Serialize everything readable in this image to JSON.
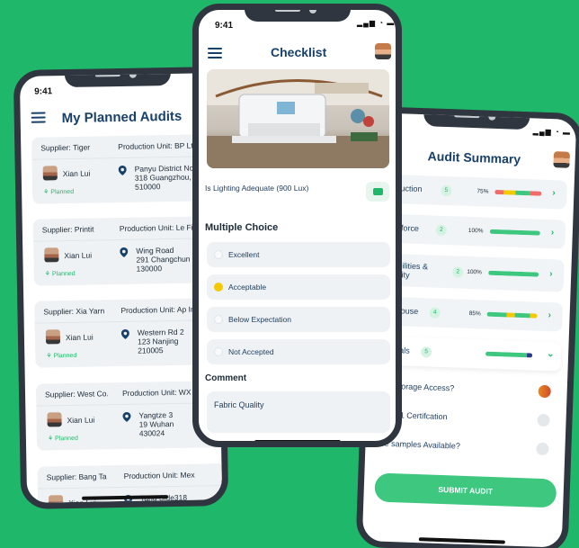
{
  "colors": {
    "background": "#1fb86a",
    "accent": "#1fb86a",
    "title": "#17406a",
    "selected": "#f5c900"
  },
  "left": {
    "time": "9:41",
    "title": "My Planned Audits",
    "audits": [
      {
        "supplier": "Supplier: Tiger",
        "unit": "Production Unit: BP Lt",
        "name": "Xian Lui",
        "status": "Planned",
        "addr": [
          "Panyu District No",
          "318 Guangzhou,",
          "510000"
        ]
      },
      {
        "supplier": "Supplier: Printit",
        "unit": "Production Unit: Le Fi",
        "name": "Xian Lui",
        "status": "Planned",
        "addr": [
          "Wing Road",
          "291 Changchun",
          "130000"
        ]
      },
      {
        "supplier": "Supplier: Xia Yarn",
        "unit": "Production Unit: Ap In",
        "name": "Xian Lui",
        "status": "Planned",
        "addr": [
          "Western Rd 2",
          "123 Nanjing",
          "210005"
        ]
      },
      {
        "supplier": "Supplier: West Co.",
        "unit": "Production Unit: WX L",
        "name": "Xian Lui",
        "status": "Planned",
        "addr": [
          "Yangtze 3",
          "19 Wuhan",
          "430024"
        ]
      },
      {
        "supplier": "Supplier: Bang Ta",
        "unit": "Production Unit: Mex",
        "name": "Xian Lui",
        "status": "",
        "addr": [
          "Tang Side318",
          "",
          ""
        ]
      }
    ]
  },
  "mid": {
    "time": "9:41",
    "title": "Checklist",
    "question": "Is Lighting Adequate (900 Lux)",
    "section": "Multiple Choice",
    "options": [
      "Excellent",
      "Acceptable",
      "Below Expectation",
      "Not Accepted"
    ],
    "selected_option": "Acceptable",
    "comment_label": "Comment",
    "comment_value": "Fabric Quality"
  },
  "right": {
    "title": "Audit Summary",
    "rows": [
      {
        "name": "duction",
        "count": "5",
        "pct": "75%",
        "fill": 0.75
      },
      {
        "name": "k force",
        "count": "2",
        "pct": "100%",
        "fill": 1.0
      },
      {
        "name": "abilities &",
        "name2": "acity",
        "count": "2",
        "pct": "100%",
        "fill": 1.0
      },
      {
        "name": "ehouse",
        "count": "4",
        "pct": "85%",
        "fill": 0.85
      },
      {
        "name": "erials",
        "count": "5",
        "pct": "",
        "fill": 0.9
      }
    ],
    "subitems": [
      "y Storage Access?",
      "9001 Certifcation",
      "re samples Available?"
    ],
    "submit": "SUBMIT AUDIT"
  }
}
